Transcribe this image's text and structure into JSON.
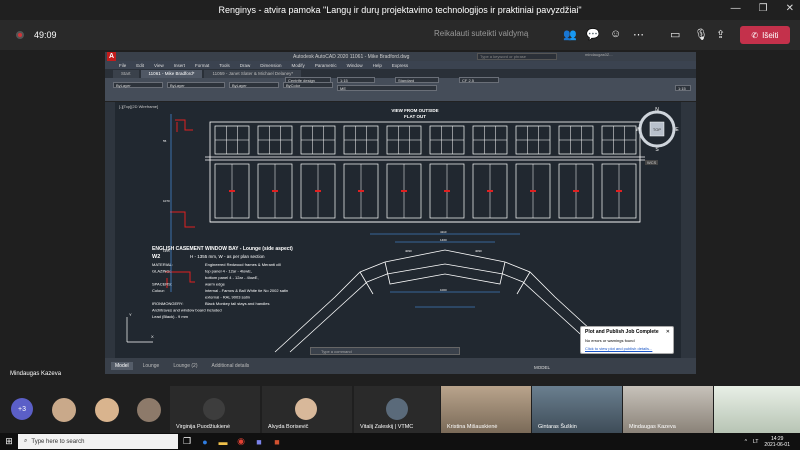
{
  "window": {
    "title": "Renginys - atvira pamoka \"Langų ir durų projektavimo technologijos ir praktiniai pavyzdžiai\""
  },
  "meeting": {
    "timer": "49:09",
    "request_control": "Reikalauti suteikti valdymą",
    "leave_label": "Išeiti",
    "presenter": "Mindaugas Kazeva",
    "more_count": "+3"
  },
  "autocad": {
    "title": "Autodesk AutoCAD 2020  11061 - Mike Bradford.dwg",
    "search_placeholder": "Type a keyword or phrase",
    "user": "mindaugas0Z...",
    "menu": [
      "File",
      "Edit",
      "View",
      "Insert",
      "Format",
      "Tools",
      "Draw",
      "Dimension",
      "Modify",
      "Parametric",
      "Window",
      "Help",
      "Express"
    ],
    "tabs": [
      "Start",
      "11061 - Mike Bradford*",
      "11059 - Janet Slater & Michael Delaney*"
    ],
    "ribbon": {
      "layer1": "ByLayer",
      "layer2": "ByLayer",
      "layer3": "ByLayer",
      "layer4": "ByColor",
      "text_style": "Centrife design",
      "scale": "1:15",
      "dim_style": "Standard",
      "plot": "CF 2.5",
      "layer_name": "ME",
      "scale2": "1:15"
    },
    "viewport_label": "[-][Top][2D Wireframe]",
    "drawing": {
      "view_title": "VIEW FROM OUTSIDE",
      "view_subtitle": "FLAT OUT",
      "spec_title": "ENGLISH CASEMENT WINDOW BAY  - Lounge (side aspect)",
      "code": "W2",
      "size": "H - 1355 mm, W - as per plan section",
      "spec_rows": [
        {
          "k": "MATERIAL:",
          "v": "Engineered Redwood frames & Meranti cill"
        },
        {
          "k": "GLAZING:",
          "v": "top panel      4 - 12ar - 4lowE,"
        },
        {
          "k": "",
          "v": "bottom panel    4 - 12ar - 4lowE,"
        },
        {
          "k": "SPACERS:",
          "v": "warm edge"
        },
        {
          "k": "Colour:",
          "v": "internal - Farrow & Ball White tie No 2002 satin"
        },
        {
          "k": "",
          "v": "external - RAL 9003 satin"
        },
        {
          "k": "IRONMONGERY:",
          "v": "Black Monkey tail stays and handles"
        },
        {
          "k": "",
          "v": "Architraves and window board included"
        },
        {
          "k": "",
          "v": "Lead (Black) - 9 mm"
        }
      ],
      "compass": {
        "n": "N",
        "s": "S",
        "e": "E",
        "w": "W",
        "top": "TOP",
        "ucs": "WCS"
      }
    },
    "command_placeholder": "Type a command",
    "layout_tabs": [
      "Model",
      "Lounge",
      "Lounge (2)",
      "Additional details"
    ],
    "model_label": "MODEL",
    "notification": {
      "title": "Plot and Publish Job Complete",
      "message": "No errors or warnings found",
      "link": "Click to view plot and publish details..."
    }
  },
  "participants": [
    {
      "name": "Virginija Puodžiukienė"
    },
    {
      "name": "Alvyda Borisevič"
    },
    {
      "name": "Vitalij Zaleskij | VTMC"
    },
    {
      "name": "Kristina Mišauskienė"
    },
    {
      "name": "Gintaras Šuškin"
    },
    {
      "name": "Mindaugas Kazeva"
    }
  ],
  "taskbar": {
    "search_placeholder": "Type here to search",
    "lang": "LT",
    "time": "14:29",
    "date": "2021-06-01"
  },
  "colors": {
    "leave": "#c4314b",
    "acad_bg": "#212830",
    "drawing_lines": "#ffffff",
    "red_annot": "#e02020",
    "dim_blue": "#4da3ff"
  }
}
